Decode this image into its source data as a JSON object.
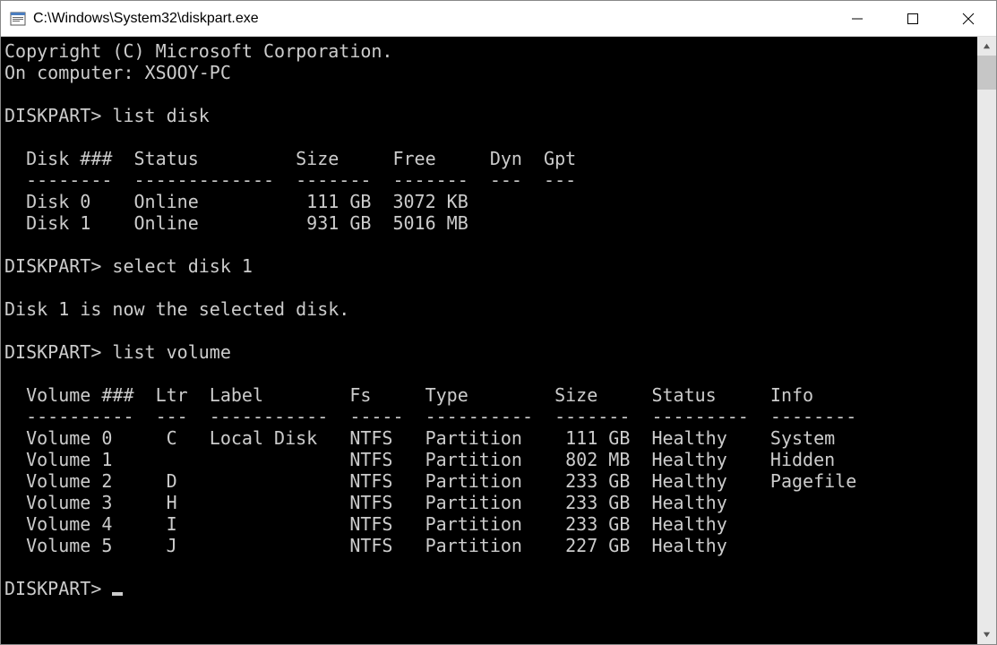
{
  "titlebar": {
    "title": "C:\\Windows\\System32\\diskpart.exe"
  },
  "terminal": {
    "copyright": "Copyright (C) Microsoft Corporation.",
    "on_computer_label": "On computer: ",
    "computer_name": "XSOOY-PC",
    "prompt": "DISKPART>",
    "cmd_list_disk": "list disk",
    "disk_header": "  Disk ###  Status         Size     Free     Dyn  Gpt",
    "disk_divider": "  --------  -------------  -------  -------  ---  ---",
    "disks": [
      "  Disk 0    Online          111 GB  3072 KB",
      "  Disk 1    Online          931 GB  5016 MB"
    ],
    "cmd_select_disk": "select disk 1",
    "select_result": "Disk 1 is now the selected disk.",
    "cmd_list_volume": "list volume",
    "vol_header": "  Volume ###  Ltr  Label        Fs     Type        Size     Status     Info",
    "vol_divider": "  ----------  ---  -----------  -----  ----------  -------  ---------  --------",
    "volumes": [
      "  Volume 0     C   Local Disk   NTFS   Partition    111 GB  Healthy    System",
      "  Volume 1                      NTFS   Partition    802 MB  Healthy    Hidden",
      "  Volume 2     D                NTFS   Partition    233 GB  Healthy    Pagefile",
      "  Volume 3     H                NTFS   Partition    233 GB  Healthy",
      "  Volume 4     I                NTFS   Partition    233 GB  Healthy",
      "  Volume 5     J                NTFS   Partition    227 GB  Healthy"
    ]
  }
}
